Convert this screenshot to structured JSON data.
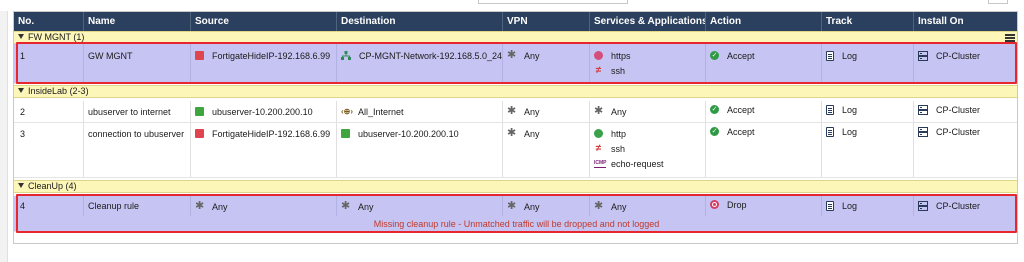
{
  "header": {
    "columns": [
      "No.",
      "Name",
      "Source",
      "Destination",
      "VPN",
      "Services & Applications",
      "Action",
      "Track",
      "Install On"
    ]
  },
  "sections": {
    "fw_mgnt": "FW MGNT",
    "fw_mgnt_range": "(1)",
    "insidelab": "InsideLab",
    "insidelab_range": "(2-3)",
    "cleanup": "CleanUp",
    "cleanup_range": "(4)"
  },
  "rules": [
    {
      "no": "1",
      "name": "GW MGNT",
      "source": "FortigateHideIP-192.168.6.99",
      "destination": "CP-MGNT-Network-192.168.5.0_24",
      "vpn": "Any",
      "services": [
        "https",
        "ssh"
      ],
      "action": "Accept",
      "track": "Log",
      "install_on": "CP-Cluster"
    },
    {
      "no": "2",
      "name": "ubuserver to internet",
      "source": "ubuserver-10.200.200.10",
      "destination": "All_Internet",
      "vpn": "Any",
      "services": [
        "Any"
      ],
      "action": "Accept",
      "track": "Log",
      "install_on": "CP-Cluster"
    },
    {
      "no": "3",
      "name": "connection to ubuserver",
      "source": "FortigateHideIP-192.168.6.99",
      "destination": "ubuserver-10.200.200.10",
      "vpn": "Any",
      "services": [
        "http",
        "ssh",
        "echo-request"
      ],
      "action": "Accept",
      "track": "Log",
      "install_on": "CP-Cluster"
    },
    {
      "no": "4",
      "name": "Cleanup rule",
      "source": "Any",
      "destination": "Any",
      "vpn": "Any",
      "services": [
        "Any"
      ],
      "action": "Drop",
      "track": "Log",
      "install_on": "CP-Cluster"
    }
  ],
  "icons": {
    "icmp_label": "ICMP",
    "internet_label": "‹⊕›"
  },
  "warning": "Missing cleanup rule - Unmatched traffic will be dropped and not logged",
  "colors": {
    "header_bg": "#2b3f5e",
    "section_bg": "#fdf6b9",
    "selected_row_bg": "#c6c4f2",
    "highlight_border": "#e8262d"
  }
}
